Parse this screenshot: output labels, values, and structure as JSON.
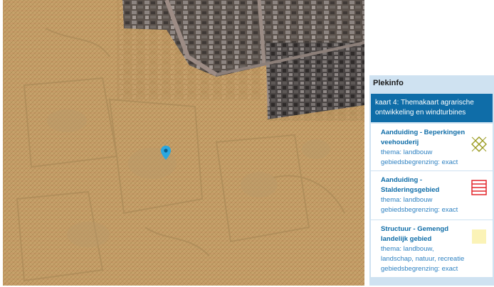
{
  "panel": {
    "title": "Plekinfo",
    "map_layer": "kaart 4: Themakaart agrarische ontwikkeling en windturbines",
    "items": [
      {
        "title": "Aanduiding - Beperkingen veehouderij",
        "theme": "thema: landbouw",
        "boundary": "gebiedsbegrenzing: exact",
        "icon": "crosshatch-olive-icon",
        "color": "#9a9a1e"
      },
      {
        "title": "Aanduiding - Stalderingsgebied",
        "theme": "thema: landbouw",
        "boundary": "gebiedsbegrenzing: exact",
        "icon": "horizontal-lines-red-icon",
        "color": "#e3262b"
      },
      {
        "title": "Structuur - Gemengd landelijk gebied",
        "theme": "thema: landbouw, landschap, natuur, recreatie",
        "boundary": "gebiedsbegrenzing: exact",
        "icon": "solid-cream-icon",
        "color": "#fbf3b7"
      }
    ]
  },
  "map": {
    "marker_icon": "location-pin-icon",
    "marker_color": "#2aa7e0",
    "overlay_color": "#d2b06f"
  }
}
